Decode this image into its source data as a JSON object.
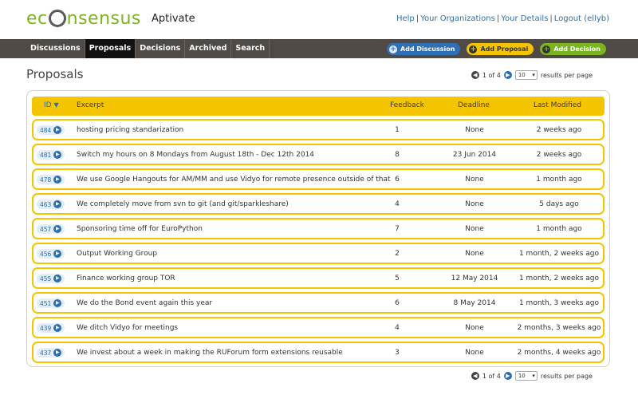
{
  "brand": {
    "logo_text": "ec",
    "logo_text_2": "nsensus",
    "sub": "Aptivate"
  },
  "toplinks": [
    "Help",
    "Your Organizations",
    "Your Details",
    "Logout (ellyb)"
  ],
  "nav": {
    "tabs": [
      "Discussions",
      "Proposals",
      "Decisions",
      "Archived",
      "Search"
    ],
    "active": "Proposals",
    "buttons": {
      "add_discussion": "Add Discussion",
      "add_proposal": "Add Proposal",
      "add_decision": "Add Decision"
    }
  },
  "page": {
    "title": "Proposals"
  },
  "pager": {
    "page_label": "1 of 4",
    "per_page": "10",
    "per_page_label": "results per page"
  },
  "table": {
    "headers": {
      "id": "ID",
      "excerpt": "Excerpt",
      "feedback": "Feedback",
      "deadline": "Deadline",
      "last_modified": "Last Modified"
    },
    "rows": [
      {
        "id": "484",
        "excerpt": "hosting pricing standarization",
        "feedback": "1",
        "deadline": "None",
        "last_modified": "2 weeks ago"
      },
      {
        "id": "481",
        "excerpt": "Switch my hours on 8 Mondays from August 18th - Dec 12th 2014",
        "feedback": "8",
        "deadline": "23 Jun 2014",
        "last_modified": "2 weeks ago"
      },
      {
        "id": "478",
        "excerpt": "We use Google Hangouts for AM/MM and use Vidyo for remote presence outside of that",
        "feedback": "6",
        "deadline": "None",
        "last_modified": "1 month ago"
      },
      {
        "id": "463",
        "excerpt": "We completely move from svn to git (and git/sparkleshare)",
        "feedback": "4",
        "deadline": "None",
        "last_modified": "5 days ago"
      },
      {
        "id": "457",
        "excerpt": "Sponsoring time off for EuroPython",
        "feedback": "7",
        "deadline": "None",
        "last_modified": "1 month ago"
      },
      {
        "id": "456",
        "excerpt": "Output Working Group",
        "feedback": "2",
        "deadline": "None",
        "last_modified": "1 month, 2 weeks ago"
      },
      {
        "id": "455",
        "excerpt": "Finance working group TOR",
        "feedback": "5",
        "deadline": "12 May 2014",
        "last_modified": "1 month, 2 weeks ago"
      },
      {
        "id": "451",
        "excerpt": "We do the Bond event again this year",
        "feedback": "6",
        "deadline": "8 May 2014",
        "last_modified": "1 month, 3 weeks ago"
      },
      {
        "id": "439",
        "excerpt": "We ditch Vidyo for meetings",
        "feedback": "4",
        "deadline": "None",
        "last_modified": "2 months, 3 weeks ago"
      },
      {
        "id": "437",
        "excerpt": "We invest about a week in making the RUForum form extensions reusable",
        "feedback": "3",
        "deadline": "None",
        "last_modified": "2 months, 4 weeks ago"
      }
    ]
  },
  "colors": {
    "accent_yellow": "#f5c400",
    "nav_bg": "#4f4a45",
    "link_blue": "#2a6fb0",
    "brand_green": "#7ab51d"
  }
}
